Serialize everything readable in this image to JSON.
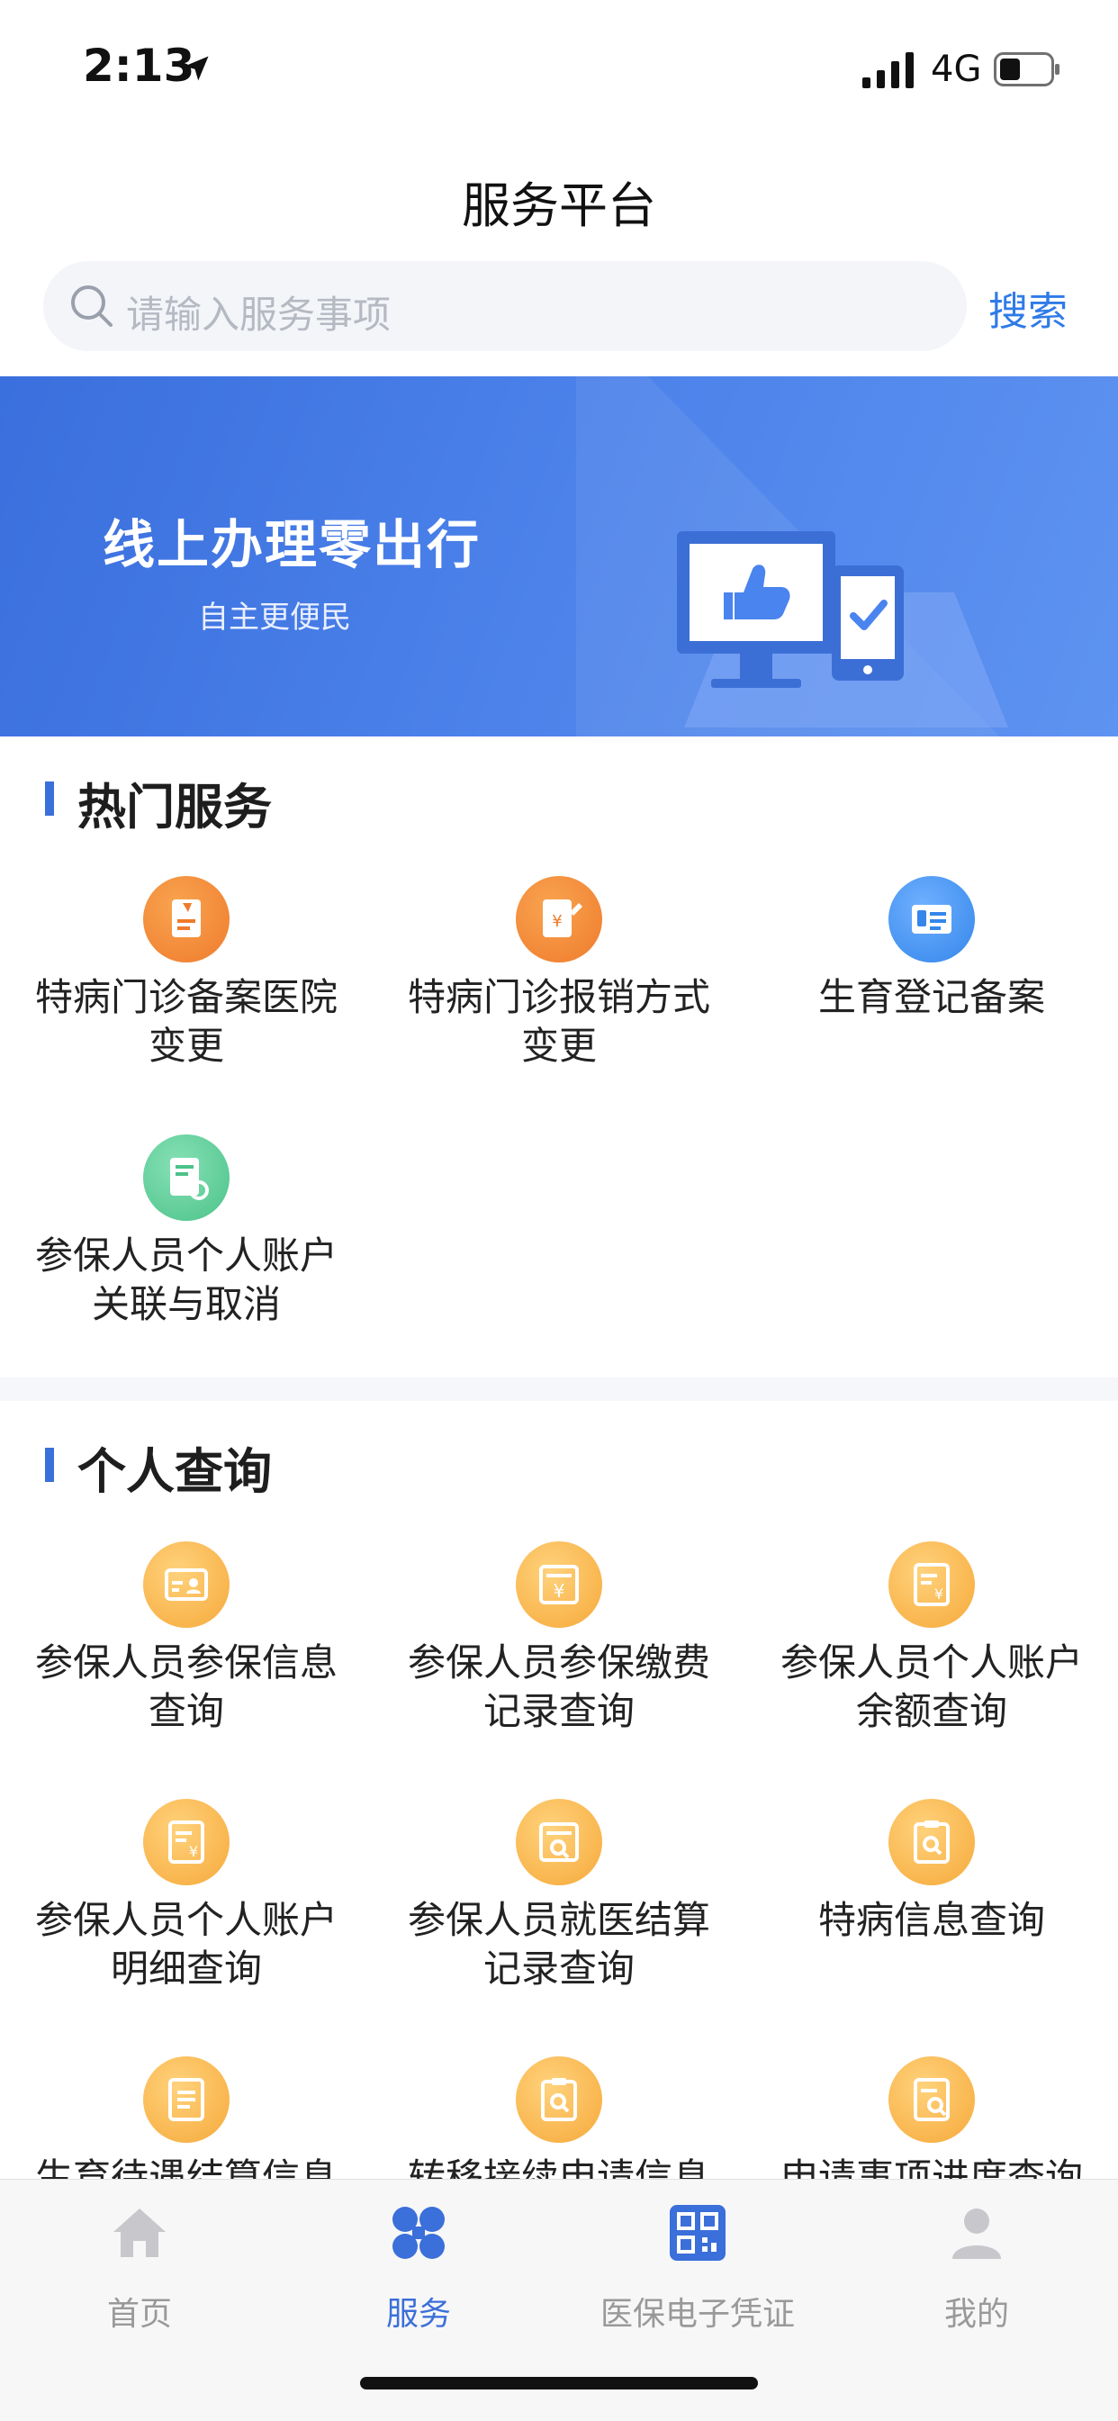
{
  "status_bar": {
    "time": "2:13",
    "network": "4G"
  },
  "header": {
    "title": "服务平台"
  },
  "search": {
    "placeholder": "请输入服务事项",
    "button_label": "搜索"
  },
  "banner": {
    "title": "线上办理零出行",
    "subtitle": "自主更便民"
  },
  "hot_services": {
    "title": "热门服务",
    "items": [
      {
        "label_line1": "特病门诊备案医院",
        "label_line2": "变更",
        "icon": "document-icon"
      },
      {
        "label_line1": "特病门诊报销方式",
        "label_line2": "变更",
        "icon": "reimbursement-icon"
      },
      {
        "label_line1": "生育登记备案",
        "label_line2": "",
        "icon": "id-card-icon"
      },
      {
        "label_line1": "参保人员个人账户",
        "label_line2": "关联与取消",
        "icon": "link-document-icon"
      }
    ]
  },
  "personal_query": {
    "title": "个人查询",
    "items": [
      {
        "label_line1": "参保人员参保信息",
        "label_line2": "查询",
        "icon": "card-user-icon"
      },
      {
        "label_line1": "参保人员参保缴费",
        "label_line2": "记录查询",
        "icon": "payment-icon"
      },
      {
        "label_line1": "参保人员个人账户",
        "label_line2": "余额查询",
        "icon": "balance-icon"
      },
      {
        "label_line1": "参保人员个人账户",
        "label_line2": "明细查询",
        "icon": "detail-icon"
      },
      {
        "label_line1": "参保人员就医结算",
        "label_line2": "记录查询",
        "icon": "search-record-icon"
      },
      {
        "label_line1": "特病信息查询",
        "label_line2": "",
        "icon": "clipboard-search-icon"
      },
      {
        "label_line1": "生育待遇结算信息",
        "label_line2": "",
        "icon": "list-icon"
      },
      {
        "label_line1": "转移接续申请信息",
        "label_line2": "",
        "icon": "clipboard-search-icon"
      },
      {
        "label_line1": "申请事项进度查询",
        "label_line2": "",
        "icon": "progress-search-icon"
      }
    ]
  },
  "tab_bar": {
    "tabs": [
      {
        "label": "首页",
        "icon": "home-icon",
        "active": false
      },
      {
        "label": "服务",
        "icon": "services-icon",
        "active": true
      },
      {
        "label": "医保电子凭证",
        "icon": "qr-code-icon",
        "active": false
      },
      {
        "label": "我的",
        "icon": "profile-icon",
        "active": false
      }
    ]
  },
  "colors": {
    "accent": "#3b6fd9",
    "link": "#2f7be8",
    "banner": "#4c82ea"
  }
}
